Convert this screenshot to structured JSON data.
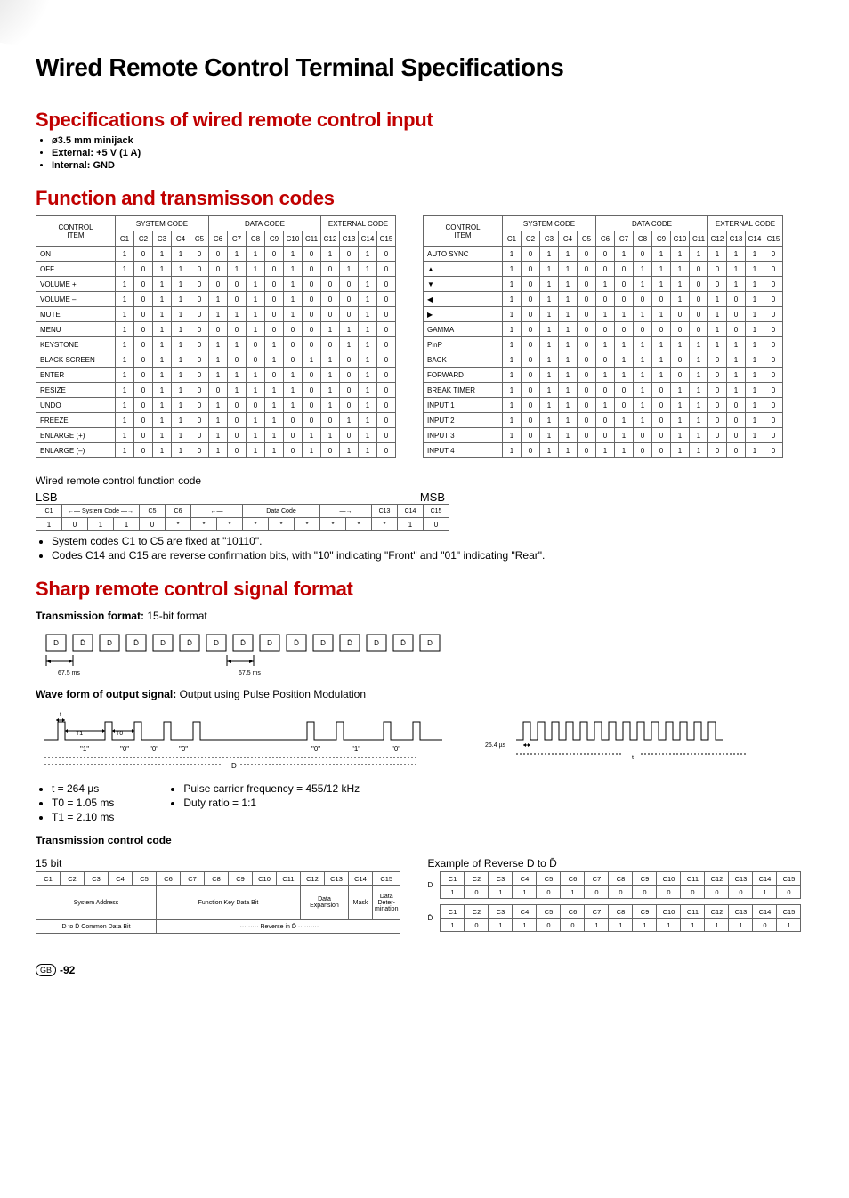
{
  "page_title": "Wired Remote Control Terminal Specifications",
  "spec_heading": "Specifications of wired remote control input",
  "spec_bullets": [
    "ø3.5 mm minijack",
    "External: +5 V (1 A)",
    "Internal: GND"
  ],
  "func_heading": "Function and transmisson codes",
  "col_headers": {
    "control_item": "CONTROL ITEM",
    "system_code": "SYSTEM CODE",
    "data_code": "DATA CODE",
    "external_code": "EXTERNAL CODE",
    "cols": [
      "C1",
      "C2",
      "C3",
      "C4",
      "C5",
      "C6",
      "C7",
      "C8",
      "C9",
      "C10",
      "C11",
      "C12",
      "C13",
      "C14",
      "C15"
    ]
  },
  "table_left": [
    {
      "item": "ON",
      "v": [
        1,
        0,
        1,
        1,
        0,
        0,
        1,
        1,
        0,
        1,
        0,
        1,
        0,
        1,
        0
      ]
    },
    {
      "item": "OFF",
      "v": [
        1,
        0,
        1,
        1,
        0,
        0,
        1,
        1,
        0,
        1,
        0,
        0,
        1,
        1,
        0
      ]
    },
    {
      "item": "VOLUME +",
      "v": [
        1,
        0,
        1,
        1,
        0,
        0,
        0,
        1,
        0,
        1,
        0,
        0,
        0,
        1,
        0
      ]
    },
    {
      "item": "VOLUME –",
      "v": [
        1,
        0,
        1,
        1,
        0,
        1,
        0,
        1,
        0,
        1,
        0,
        0,
        0,
        1,
        0
      ]
    },
    {
      "item": "MUTE",
      "v": [
        1,
        0,
        1,
        1,
        0,
        1,
        1,
        1,
        0,
        1,
        0,
        0,
        0,
        1,
        0
      ]
    },
    {
      "item": "MENU",
      "v": [
        1,
        0,
        1,
        1,
        0,
        0,
        0,
        1,
        0,
        0,
        0,
        1,
        1,
        1,
        0
      ]
    },
    {
      "item": "KEYSTONE",
      "v": [
        1,
        0,
        1,
        1,
        0,
        1,
        1,
        0,
        1,
        0,
        0,
        0,
        1,
        1,
        0
      ]
    },
    {
      "item": "BLACK SCREEN",
      "v": [
        1,
        0,
        1,
        1,
        0,
        1,
        0,
        0,
        1,
        0,
        1,
        1,
        0,
        1,
        0
      ]
    },
    {
      "item": "ENTER",
      "v": [
        1,
        0,
        1,
        1,
        0,
        1,
        1,
        1,
        0,
        1,
        0,
        1,
        0,
        1,
        0
      ]
    },
    {
      "item": "RESIZE",
      "v": [
        1,
        0,
        1,
        1,
        0,
        0,
        1,
        1,
        1,
        1,
        0,
        1,
        0,
        1,
        0
      ]
    },
    {
      "item": "UNDO",
      "v": [
        1,
        0,
        1,
        1,
        0,
        1,
        0,
        0,
        1,
        1,
        0,
        1,
        0,
        1,
        0
      ]
    },
    {
      "item": "FREEZE",
      "v": [
        1,
        0,
        1,
        1,
        0,
        1,
        0,
        1,
        1,
        0,
        0,
        0,
        1,
        1,
        0
      ]
    },
    {
      "item": "ENLARGE (+)",
      "v": [
        1,
        0,
        1,
        1,
        0,
        1,
        0,
        1,
        1,
        0,
        1,
        1,
        0,
        1,
        0
      ]
    },
    {
      "item": "ENLARGE (–)",
      "v": [
        1,
        0,
        1,
        1,
        0,
        1,
        0,
        1,
        1,
        0,
        1,
        0,
        1,
        1,
        0
      ]
    }
  ],
  "table_right": [
    {
      "item": "AUTO SYNC",
      "v": [
        1,
        0,
        1,
        1,
        0,
        0,
        1,
        0,
        1,
        1,
        1,
        1,
        1,
        1,
        0
      ]
    },
    {
      "item": "▲",
      "v": [
        1,
        0,
        1,
        1,
        0,
        0,
        0,
        1,
        1,
        1,
        0,
        0,
        1,
        1,
        0
      ]
    },
    {
      "item": "▼",
      "v": [
        1,
        0,
        1,
        1,
        0,
        1,
        0,
        1,
        1,
        1,
        0,
        0,
        1,
        1,
        0
      ]
    },
    {
      "item": "◀",
      "v": [
        1,
        0,
        1,
        1,
        0,
        0,
        0,
        0,
        0,
        1,
        0,
        1,
        0,
        1,
        0
      ]
    },
    {
      "item": "▶",
      "v": [
        1,
        0,
        1,
        1,
        0,
        1,
        1,
        1,
        1,
        0,
        0,
        1,
        0,
        1,
        0
      ]
    },
    {
      "item": "GAMMA",
      "v": [
        1,
        0,
        1,
        1,
        0,
        0,
        0,
        0,
        0,
        0,
        0,
        1,
        0,
        1,
        0
      ]
    },
    {
      "item": "PinP",
      "v": [
        1,
        0,
        1,
        1,
        0,
        1,
        1,
        1,
        1,
        1,
        1,
        1,
        1,
        1,
        0
      ]
    },
    {
      "item": "BACK",
      "v": [
        1,
        0,
        1,
        1,
        0,
        0,
        1,
        1,
        1,
        0,
        1,
        0,
        1,
        1,
        0
      ]
    },
    {
      "item": "FORWARD",
      "v": [
        1,
        0,
        1,
        1,
        0,
        1,
        1,
        1,
        1,
        0,
        1,
        0,
        1,
        1,
        0
      ]
    },
    {
      "item": "BREAK TIMER",
      "v": [
        1,
        0,
        1,
        1,
        0,
        0,
        0,
        1,
        0,
        1,
        1,
        0,
        1,
        1,
        0
      ]
    },
    {
      "item": "INPUT 1",
      "v": [
        1,
        0,
        1,
        1,
        0,
        1,
        0,
        1,
        0,
        1,
        1,
        0,
        0,
        1,
        0
      ]
    },
    {
      "item": "INPUT 2",
      "v": [
        1,
        0,
        1,
        1,
        0,
        0,
        1,
        1,
        0,
        1,
        1,
        0,
        0,
        1,
        0
      ]
    },
    {
      "item": "INPUT 3",
      "v": [
        1,
        0,
        1,
        1,
        0,
        0,
        1,
        0,
        0,
        1,
        1,
        0,
        0,
        1,
        0
      ]
    },
    {
      "item": "INPUT 4",
      "v": [
        1,
        0,
        1,
        1,
        0,
        1,
        1,
        0,
        0,
        1,
        1,
        0,
        0,
        1,
        0
      ]
    }
  ],
  "func_code_label": "Wired remote control function code",
  "lsb": "LSB",
  "msb": "MSB",
  "bitrow_headers": [
    "C1",
    "",
    "System Code",
    "",
    "C5",
    "C6",
    "",
    "",
    "",
    "Data Code",
    "",
    "",
    "",
    "C13",
    "C14",
    "C15"
  ],
  "bitrow_values": [
    "1",
    "0",
    "1",
    "1",
    "0",
    "*",
    "*",
    "*",
    "*",
    "*",
    "*",
    "*",
    "*",
    "*",
    "1",
    "0"
  ],
  "bitrow_notes": [
    "System codes C1 to C5 are fixed at \"10110\".",
    "Codes C14 and C15 are reverse confirmation bits, with \"10\" indicating \"Front\" and \"01\" indicating \"Rear\"."
  ],
  "signal_heading": "Sharp remote control signal  format",
  "trans_format_label": "Transmission format:",
  "trans_format_val": "15-bit format",
  "trans_cells": [
    "D",
    "D̄",
    "D",
    "D̄",
    "D",
    "D̄",
    "D",
    "D̄",
    "D",
    "D̄",
    "D",
    "D̄",
    "D",
    "D̄",
    "D"
  ],
  "trans_ms": "67.5 ms",
  "wave_label": "Wave form of output signal:",
  "wave_val": "Output using Pulse Position Modulation",
  "wave_tags": [
    "\"1\"",
    "\"0\"",
    "\"0\"",
    "\"0\"",
    "\"0\"",
    "\"1\"",
    "\"0\""
  ],
  "wave_t1": "T1",
  "wave_t0": "T0",
  "wave_t": "t",
  "wave_D": "D",
  "wave_264": "26.4 µs",
  "params_left": [
    "t = 264 µs",
    "T0 = 1.05 ms",
    "T1 = 2.10 ms"
  ],
  "params_right": [
    "Pulse carrier frequency = 455/12 kHz",
    "Duty ratio = 1:1"
  ],
  "tcc_heading": "Transmission control code",
  "tcc_15bit": "15 bit",
  "tcc_cols": [
    "C1",
    "C2",
    "C3",
    "C4",
    "C5",
    "C6",
    "C7",
    "C8",
    "C9",
    "C10",
    "C11",
    "C12",
    "C13",
    "C14",
    "C15"
  ],
  "tcc_labels": {
    "sys_addr": "System Address",
    "fkey": "Function Key Data Bit",
    "data_exp": "Data Expansion",
    "mask": "Mask",
    "det": "Data Deter-mination",
    "common": "D to D̄ Common Data Bit",
    "rev_in": "Reverse in D̄"
  },
  "example_label": "Example of Reverse D to D̄",
  "ex_D": "D",
  "ex_Dbar": "D̄",
  "ex_row_d": [
    1,
    0,
    1,
    1,
    0,
    1,
    0,
    0,
    0,
    0,
    0,
    0,
    0,
    1,
    0
  ],
  "ex_row_db": [
    1,
    0,
    1,
    1,
    0,
    0,
    1,
    1,
    1,
    1,
    1,
    1,
    1,
    0,
    1
  ],
  "page_number": "-92",
  "gb": "GB",
  "chart_data": {
    "type": "table",
    "title": "Wired remote control function & transmission codes (15-bit)",
    "columns": [
      "C1",
      "C2",
      "C3",
      "C4",
      "C5",
      "C6",
      "C7",
      "C8",
      "C9",
      "C10",
      "C11",
      "C12",
      "C13",
      "C14",
      "C15"
    ],
    "groups": {
      "system_code": "C1-C5",
      "data_code": "C6-C11",
      "external_code": "C12-C15"
    },
    "series": [
      {
        "name": "ON",
        "values": [
          1,
          0,
          1,
          1,
          0,
          0,
          1,
          1,
          0,
          1,
          0,
          1,
          0,
          1,
          0
        ]
      },
      {
        "name": "OFF",
        "values": [
          1,
          0,
          1,
          1,
          0,
          0,
          1,
          1,
          0,
          1,
          0,
          0,
          1,
          1,
          0
        ]
      },
      {
        "name": "VOLUME +",
        "values": [
          1,
          0,
          1,
          1,
          0,
          0,
          0,
          1,
          0,
          1,
          0,
          0,
          0,
          1,
          0
        ]
      },
      {
        "name": "VOLUME –",
        "values": [
          1,
          0,
          1,
          1,
          0,
          1,
          0,
          1,
          0,
          1,
          0,
          0,
          0,
          1,
          0
        ]
      },
      {
        "name": "MUTE",
        "values": [
          1,
          0,
          1,
          1,
          0,
          1,
          1,
          1,
          0,
          1,
          0,
          0,
          0,
          1,
          0
        ]
      },
      {
        "name": "MENU",
        "values": [
          1,
          0,
          1,
          1,
          0,
          0,
          0,
          1,
          0,
          0,
          0,
          1,
          1,
          1,
          0
        ]
      },
      {
        "name": "KEYSTONE",
        "values": [
          1,
          0,
          1,
          1,
          0,
          1,
          1,
          0,
          1,
          0,
          0,
          0,
          1,
          1,
          0
        ]
      },
      {
        "name": "BLACK SCREEN",
        "values": [
          1,
          0,
          1,
          1,
          0,
          1,
          0,
          0,
          1,
          0,
          1,
          1,
          0,
          1,
          0
        ]
      },
      {
        "name": "ENTER",
        "values": [
          1,
          0,
          1,
          1,
          0,
          1,
          1,
          1,
          0,
          1,
          0,
          1,
          0,
          1,
          0
        ]
      },
      {
        "name": "RESIZE",
        "values": [
          1,
          0,
          1,
          1,
          0,
          0,
          1,
          1,
          1,
          1,
          0,
          1,
          0,
          1,
          0
        ]
      },
      {
        "name": "UNDO",
        "values": [
          1,
          0,
          1,
          1,
          0,
          1,
          0,
          0,
          1,
          1,
          0,
          1,
          0,
          1,
          0
        ]
      },
      {
        "name": "FREEZE",
        "values": [
          1,
          0,
          1,
          1,
          0,
          1,
          0,
          1,
          1,
          0,
          0,
          0,
          1,
          1,
          0
        ]
      },
      {
        "name": "ENLARGE (+)",
        "values": [
          1,
          0,
          1,
          1,
          0,
          1,
          0,
          1,
          1,
          0,
          1,
          1,
          0,
          1,
          0
        ]
      },
      {
        "name": "ENLARGE (–)",
        "values": [
          1,
          0,
          1,
          1,
          0,
          1,
          0,
          1,
          1,
          0,
          1,
          0,
          1,
          1,
          0
        ]
      },
      {
        "name": "AUTO SYNC",
        "values": [
          1,
          0,
          1,
          1,
          0,
          0,
          1,
          0,
          1,
          1,
          1,
          1,
          1,
          1,
          0
        ]
      },
      {
        "name": "▲",
        "values": [
          1,
          0,
          1,
          1,
          0,
          0,
          0,
          1,
          1,
          1,
          0,
          0,
          1,
          1,
          0
        ]
      },
      {
        "name": "▼",
        "values": [
          1,
          0,
          1,
          1,
          0,
          1,
          0,
          1,
          1,
          1,
          0,
          0,
          1,
          1,
          0
        ]
      },
      {
        "name": "◀",
        "values": [
          1,
          0,
          1,
          1,
          0,
          0,
          0,
          0,
          0,
          1,
          0,
          1,
          0,
          1,
          0
        ]
      },
      {
        "name": "▶",
        "values": [
          1,
          0,
          1,
          1,
          0,
          1,
          1,
          1,
          1,
          0,
          0,
          1,
          0,
          1,
          0
        ]
      },
      {
        "name": "GAMMA",
        "values": [
          1,
          0,
          1,
          1,
          0,
          0,
          0,
          0,
          0,
          0,
          0,
          1,
          0,
          1,
          0
        ]
      },
      {
        "name": "PinP",
        "values": [
          1,
          0,
          1,
          1,
          0,
          1,
          1,
          1,
          1,
          1,
          1,
          1,
          1,
          1,
          0
        ]
      },
      {
        "name": "BACK",
        "values": [
          1,
          0,
          1,
          1,
          0,
          0,
          1,
          1,
          1,
          0,
          1,
          0,
          1,
          1,
          0
        ]
      },
      {
        "name": "FORWARD",
        "values": [
          1,
          0,
          1,
          1,
          0,
          1,
          1,
          1,
          1,
          0,
          1,
          0,
          1,
          1,
          0
        ]
      },
      {
        "name": "BREAK TIMER",
        "values": [
          1,
          0,
          1,
          1,
          0,
          0,
          0,
          1,
          0,
          1,
          1,
          0,
          1,
          1,
          0
        ]
      },
      {
        "name": "INPUT 1",
        "values": [
          1,
          0,
          1,
          1,
          0,
          1,
          0,
          1,
          0,
          1,
          1,
          0,
          0,
          1,
          0
        ]
      },
      {
        "name": "INPUT 2",
        "values": [
          1,
          0,
          1,
          1,
          0,
          0,
          1,
          1,
          0,
          1,
          1,
          0,
          0,
          1,
          0
        ]
      },
      {
        "name": "INPUT 3",
        "values": [
          1,
          0,
          1,
          1,
          0,
          0,
          1,
          0,
          0,
          1,
          1,
          0,
          0,
          1,
          0
        ]
      },
      {
        "name": "INPUT 4",
        "values": [
          1,
          0,
          1,
          1,
          0,
          1,
          1,
          0,
          0,
          1,
          1,
          0,
          0,
          1,
          0
        ]
      }
    ]
  }
}
